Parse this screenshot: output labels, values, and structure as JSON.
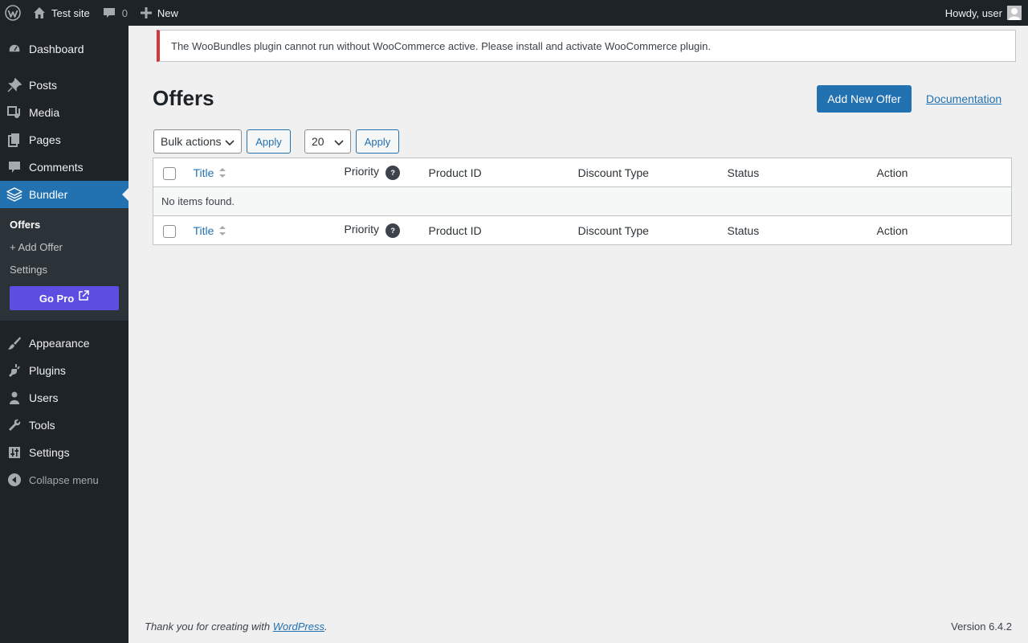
{
  "adminbar": {
    "site_name": "Test site",
    "comments_count": "0",
    "new_label": "New",
    "howdy": "Howdy, user"
  },
  "sidebar": {
    "items_top": [
      {
        "label": "Dashboard",
        "icon": "dashboard-icon"
      }
    ],
    "items_main": [
      {
        "label": "Posts",
        "icon": "pushpin-icon"
      },
      {
        "label": "Media",
        "icon": "media-icon"
      },
      {
        "label": "Pages",
        "icon": "pages-icon"
      },
      {
        "label": "Comments",
        "icon": "comments-icon"
      },
      {
        "label": "Bundler",
        "icon": "layers-icon"
      }
    ],
    "submenu": {
      "offers": "Offers",
      "add_offer": "+ Add Offer",
      "settings": "Settings",
      "go_pro": "Go Pro"
    },
    "items_bottom": [
      {
        "label": "Appearance",
        "icon": "brush-icon"
      },
      {
        "label": "Plugins",
        "icon": "plug-icon"
      },
      {
        "label": "Users",
        "icon": "users-icon"
      },
      {
        "label": "Tools",
        "icon": "wrench-icon"
      },
      {
        "label": "Settings",
        "icon": "settings-icon"
      }
    ],
    "collapse": "Collapse menu"
  },
  "notice": {
    "text": "The WooBundles plugin cannot run without WooCommerce active. Please install and activate WooCommerce plugin.",
    "color": "#d63638"
  },
  "page": {
    "title": "Offers",
    "add_button": "Add New Offer",
    "doc_link": "Documentation"
  },
  "tablenav": {
    "bulk_actions": "Bulk actions",
    "apply": "Apply",
    "per_page": "20",
    "apply2": "Apply"
  },
  "table": {
    "columns": [
      "Title",
      "Priority",
      "Product ID",
      "Discount Type",
      "Status",
      "Action"
    ],
    "help_glyph": "?",
    "empty": "No items found."
  },
  "footer": {
    "thanks_prefix": "Thank you for creating with ",
    "thanks_link": "WordPress",
    "thanks_suffix": ".",
    "version": "Version 6.4.2"
  },
  "colors": {
    "accent": "#2271b1",
    "go_pro": "#5b4ee0",
    "sidebar_bg": "#1d2327"
  }
}
